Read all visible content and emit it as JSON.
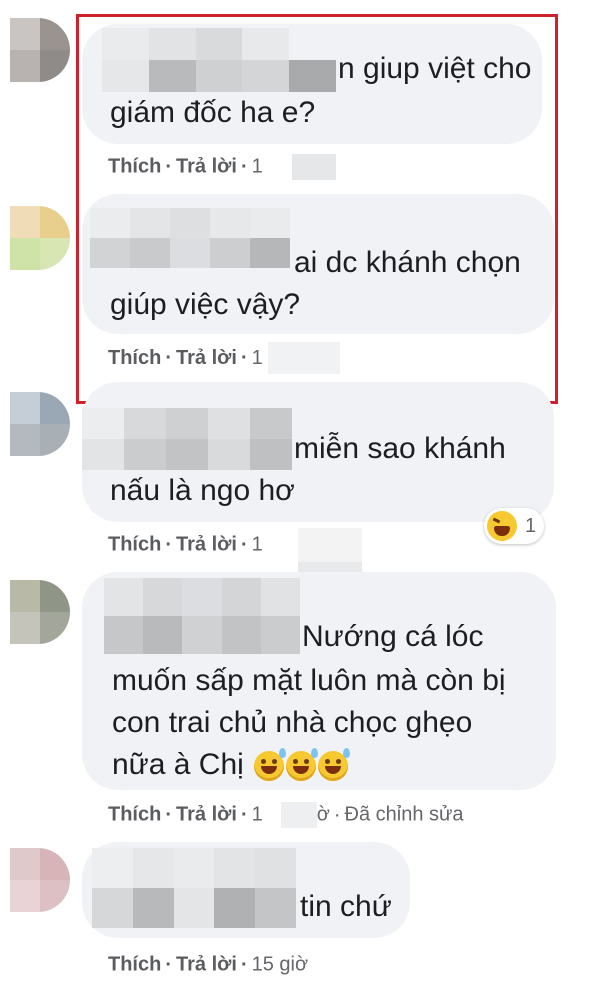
{
  "comments": [
    {
      "text_line1_suffix": "n giup việt cho",
      "text_line2": "giám đốc ha e?",
      "like": "Thích",
      "reply": "Trả lời",
      "time_prefix": "1"
    },
    {
      "text_line1_suffix": "ai dc khánh chọn",
      "text_line2": "giúp việc vậy?",
      "like": "Thích",
      "reply": "Trả lời",
      "time_prefix": "1"
    },
    {
      "text_line1_suffix": "miễn sao khánh",
      "text_line2": "nấu là ngo hơ",
      "like": "Thích",
      "reply": "Trả lời",
      "time_prefix": "1",
      "reaction_count": "1",
      "reaction_icon": "laughing-face-icon"
    },
    {
      "text_line1_suffix": "Nướng cá lóc",
      "text_line2": "muốn sấp mặt luôn mà còn bị",
      "text_line3": "con trai chủ nhà chọc ghẹo",
      "text_line4": "nữa à Chị",
      "like": "Thích",
      "reply": "Trả lời",
      "time_prefix": "1",
      "time_suffix": "ờ",
      "edited": "Đã chỉnh sửa",
      "emoji_icon": "grinning-sweat-face-icon"
    },
    {
      "text_line1_suffix": "tin chứ",
      "like": "Thích",
      "reply": "Trả lời",
      "time": "15 giờ"
    }
  ],
  "separator": "·",
  "colors": {
    "bubble": "#f0f2f5",
    "highlight_border": "#d0202a",
    "action_text": "#5a5c60"
  }
}
